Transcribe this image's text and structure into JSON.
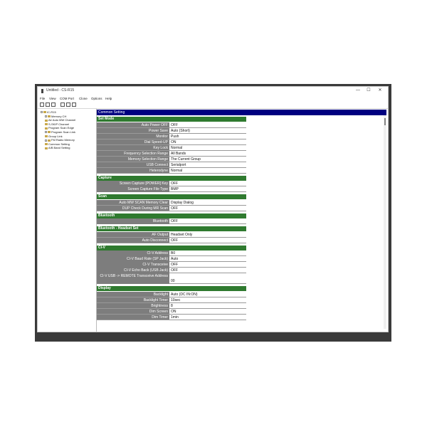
{
  "window": {
    "title": "Untitled - CS-R15",
    "min_glyph": "—",
    "max_glyph": "☐",
    "close_glyph": "✕"
  },
  "menu": [
    "File",
    "View",
    "COM Port",
    "Clone",
    "Options",
    "Help"
  ],
  "tree": [
    {
      "label": "IC-R15",
      "level": 0,
      "expander": true
    },
    {
      "label": "Memory CH",
      "level": 1,
      "expander": true
    },
    {
      "label": "Air Auto MW Channel",
      "level": 1,
      "expander": false
    },
    {
      "label": "S-SKIP Channel",
      "level": 1,
      "expander": false
    },
    {
      "label": "Program Scan Edge",
      "level": 1,
      "expander": false
    },
    {
      "label": "Program Scan Link",
      "level": 1,
      "expander": true
    },
    {
      "label": "Group Link",
      "level": 1,
      "expander": false
    },
    {
      "label": "FM Radio Memory",
      "level": 1,
      "expander": true
    },
    {
      "label": "Common Setting",
      "level": 1,
      "expander": false
    },
    {
      "label": "A/B Band Setting",
      "level": 1,
      "expander": false
    }
  ],
  "panel_title": "Common Setting",
  "sections": [
    {
      "title": "Set Mode",
      "rows": [
        {
          "label": "Auto Power OFF",
          "value": "OFF"
        },
        {
          "label": "Power Save",
          "value": "Auto (Short)"
        },
        {
          "label": "Monitor",
          "value": "Push"
        },
        {
          "label": "Dial Speed-UP",
          "value": "ON"
        },
        {
          "label": "Key Lock",
          "value": "Normal"
        },
        {
          "label": "Frequency Selection Range",
          "value": "All Bands"
        },
        {
          "label": "Memory Selection Range",
          "value": "The Current Group"
        },
        {
          "label": "USB Connect",
          "value": "Serialport"
        },
        {
          "label": "Heterodyne",
          "value": "Normal"
        }
      ]
    },
    {
      "title": "Capture",
      "rows": [
        {
          "label": "Screen Capture [POWER] Key",
          "value": "OFF"
        },
        {
          "label": "Screen Capture File Type",
          "value": "BMP"
        }
      ]
    },
    {
      "title": "Scan",
      "rows": [
        {
          "label": "Auto MW SCAN Memory Clear",
          "value": "Display Dialog"
        },
        {
          "label": "DUP Check During MR Scan",
          "value": "OFF"
        }
      ]
    },
    {
      "title": "Bluetooth",
      "rows": [
        {
          "label": "Bluetooth",
          "value": "OFF"
        }
      ]
    },
    {
      "title": "Bluetooth - Headset Set",
      "rows": [
        {
          "label": "AF Output",
          "value": "Headset Only"
        },
        {
          "label": "Auto Disconnect",
          "value": "OFF"
        }
      ]
    },
    {
      "title": "CI-V",
      "rows": [
        {
          "label": "CI-V Address",
          "value": "B0"
        },
        {
          "label": "CI-V Baud Rate (SP Jack)",
          "value": "Auto"
        },
        {
          "label": "CI-V Transceive",
          "value": "OFF"
        },
        {
          "label": "CI-V Echo Back (USB Jack)",
          "value": "OFF"
        },
        {
          "label": "CI-V USB -> REMOTE Transceive Address",
          "value": "00",
          "tall": true
        }
      ]
    },
    {
      "title": "Display",
      "rows": [
        {
          "label": "Backlight",
          "value": "Auto (DC IN:ON)"
        },
        {
          "label": "Backlight Timer",
          "value": "10sec"
        },
        {
          "label": "Brightness",
          "value": "8"
        },
        {
          "label": "Dim Screen",
          "value": "ON"
        },
        {
          "label": "Dim Timer",
          "value": "1min"
        }
      ]
    }
  ]
}
